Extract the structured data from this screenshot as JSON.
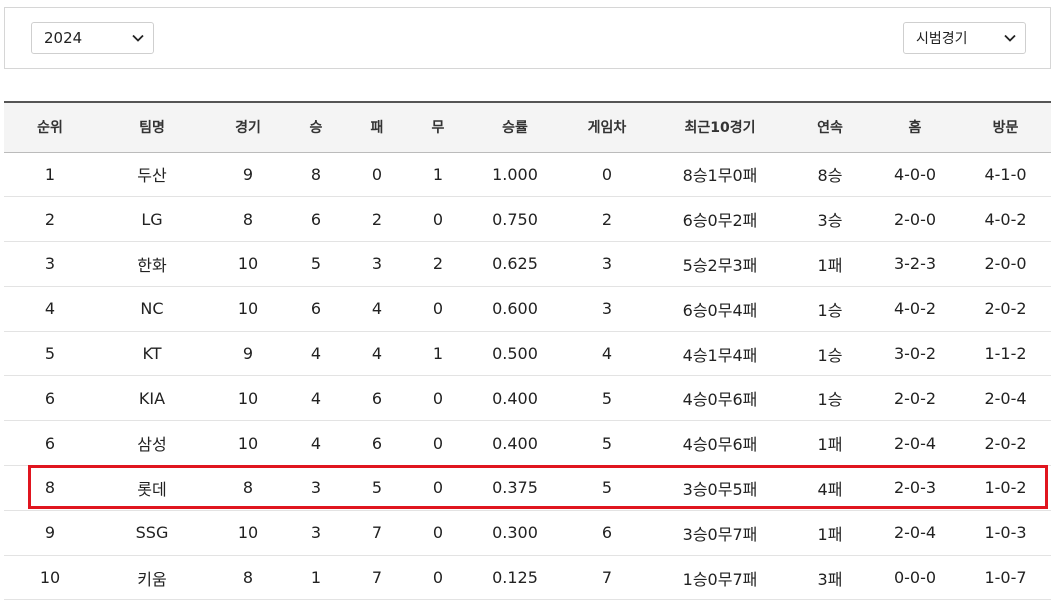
{
  "filters": {
    "year": "2024",
    "game_type": "시범경기"
  },
  "colors": {
    "highlight": "#e0151f",
    "header_bg": "#f4f4f4"
  },
  "icons": {
    "year_dropdown": "chevron-down-icon",
    "type_dropdown": "chevron-down-icon"
  },
  "table": {
    "headers": [
      "순위",
      "팀명",
      "경기",
      "승",
      "패",
      "무",
      "승률",
      "게임차",
      "최근10경기",
      "연속",
      "홈",
      "방문"
    ],
    "rows": [
      [
        "1",
        "두산",
        "9",
        "8",
        "0",
        "1",
        "1.000",
        "0",
        "8승1무0패",
        "8승",
        "4-0-0",
        "4-1-0"
      ],
      [
        "2",
        "LG",
        "8",
        "6",
        "2",
        "0",
        "0.750",
        "2",
        "6승0무2패",
        "3승",
        "2-0-0",
        "4-0-2"
      ],
      [
        "3",
        "한화",
        "10",
        "5",
        "3",
        "2",
        "0.625",
        "3",
        "5승2무3패",
        "1패",
        "3-2-3",
        "2-0-0"
      ],
      [
        "4",
        "NC",
        "10",
        "6",
        "4",
        "0",
        "0.600",
        "3",
        "6승0무4패",
        "1승",
        "4-0-2",
        "2-0-2"
      ],
      [
        "5",
        "KT",
        "9",
        "4",
        "4",
        "1",
        "0.500",
        "4",
        "4승1무4패",
        "1승",
        "3-0-2",
        "1-1-2"
      ],
      [
        "6",
        "KIA",
        "10",
        "4",
        "6",
        "0",
        "0.400",
        "5",
        "4승0무6패",
        "1승",
        "2-0-2",
        "2-0-4"
      ],
      [
        "6",
        "삼성",
        "10",
        "4",
        "6",
        "0",
        "0.400",
        "5",
        "4승0무6패",
        "1패",
        "2-0-4",
        "2-0-2"
      ],
      [
        "8",
        "롯데",
        "8",
        "3",
        "5",
        "0",
        "0.375",
        "5",
        "3승0무5패",
        "4패",
        "2-0-3",
        "1-0-2"
      ],
      [
        "9",
        "SSG",
        "10",
        "3",
        "7",
        "0",
        "0.300",
        "6",
        "3승0무7패",
        "1패",
        "2-0-4",
        "1-0-3"
      ],
      [
        "10",
        "키움",
        "8",
        "1",
        "7",
        "0",
        "0.125",
        "7",
        "1승0무7패",
        "3패",
        "0-0-0",
        "1-0-7"
      ]
    ]
  }
}
